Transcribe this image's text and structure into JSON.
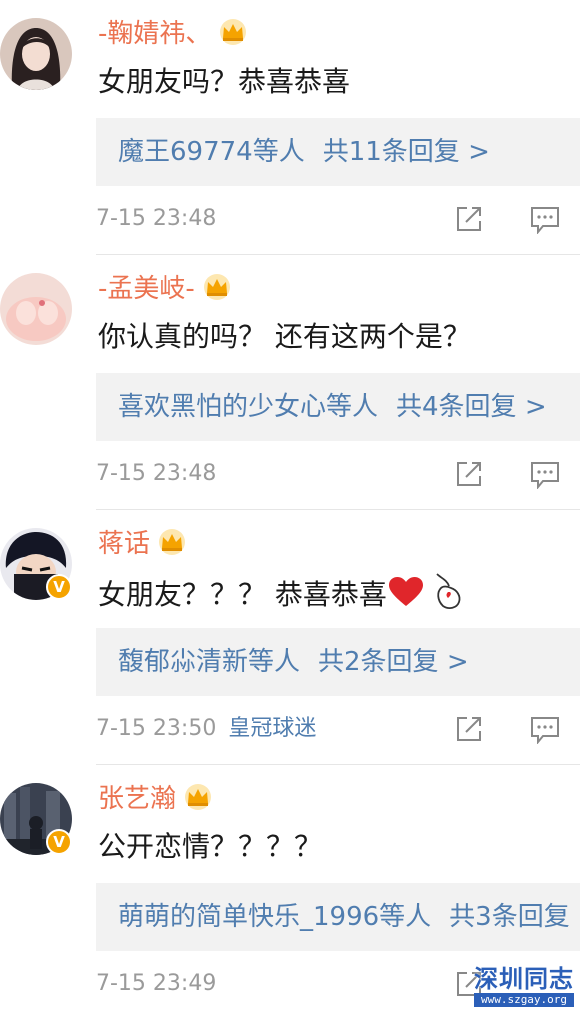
{
  "comments": [
    {
      "username": "-鞠婧祎、",
      "text": "女朋友吗？恭喜恭喜",
      "reply_names": "魔王69774等人",
      "reply_count": "共11条回复 >",
      "time": "7-15 23:48",
      "source": "",
      "verified": false,
      "avatar_icon": "female-portrait-avatar"
    },
    {
      "username": "-孟美岐-",
      "text": "你认真的吗？ 还有这两个是？",
      "reply_names": "喜欢黑怕的少女心等人",
      "reply_count": "共4条回复 >",
      "time": "7-15 23:48",
      "source": "",
      "verified": false,
      "avatar_icon": "pink-portrait-avatar"
    },
    {
      "username": "蒋话",
      "text": "女朋友？？？ 恭喜恭喜",
      "reply_names": "馥郁尛清新等人",
      "reply_count": "共2条回复 >",
      "time": "7-15 23:50",
      "source": "皇冠球迷",
      "verified": true,
      "verified_mark": "V",
      "avatar_icon": "anime-character-avatar"
    },
    {
      "username": "张艺瀚",
      "text": "公开恋情？？？？",
      "reply_names": "萌萌的简单快乐_1996等人",
      "reply_count": "共3条回复",
      "time": "7-15 23:49",
      "source": "",
      "verified": true,
      "verified_mark": "V",
      "avatar_icon": "city-night-avatar"
    }
  ],
  "icons": {
    "crown": "crown-icon",
    "heart": "red-heart-emoji",
    "finger_heart": "finger-heart-emoji",
    "share": "share-icon",
    "comment": "comment-icon"
  },
  "colors": {
    "username": "#eb7350",
    "link": "#507daf",
    "meta": "#9a9a9a",
    "reply_bg": "#f2f2f2",
    "verified_badge": "#f5a300",
    "crown": "#f5a300"
  },
  "watermark": {
    "title": "深圳同志",
    "url": "www.szgay.org"
  }
}
